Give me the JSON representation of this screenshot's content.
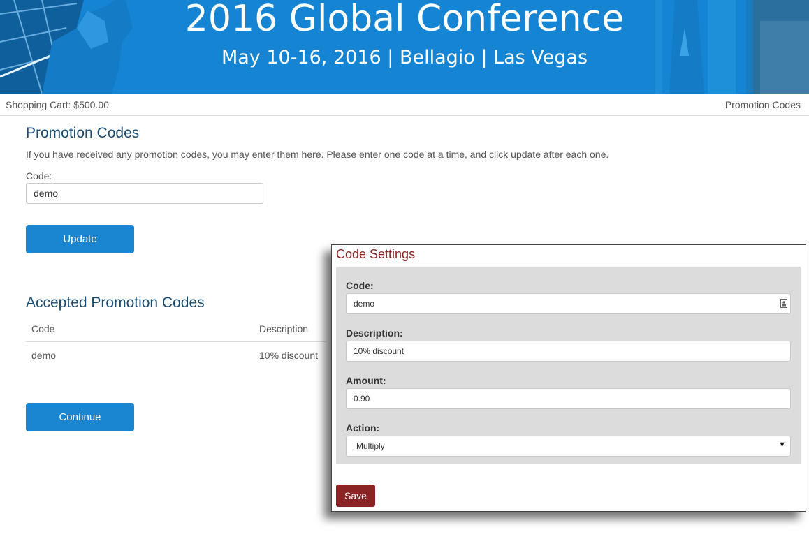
{
  "banner": {
    "title": "2016 Global Conference",
    "subtitle": "May 10-16, 2016 | Bellagio | Las Vegas",
    "color": "#1585d3"
  },
  "topbar": {
    "cart": "Shopping Cart: $500.00",
    "promo_link": "Promotion Codes"
  },
  "promo": {
    "heading": "Promotion Codes",
    "intro": "If you have received any promotion codes, you may enter them here. Please enter one code at a time, and click update after each one.",
    "code_label": "Code:",
    "code_value": "demo",
    "update_label": "Update"
  },
  "accepted": {
    "heading": "Accepted Promotion Codes",
    "columns": [
      "Code",
      "Description"
    ],
    "rows": [
      {
        "code": "demo",
        "description": "10% discount"
      }
    ],
    "continue_label": "Continue"
  },
  "settings": {
    "title": "Code Settings",
    "code_label": "Code:",
    "code_value": "demo",
    "description_label": "Description:",
    "description_value": "10% discount",
    "amount_label": "Amount:",
    "amount_value": "0.90",
    "action_label": "Action:",
    "action_value": "Multiply",
    "save_label": "Save",
    "accent": "#8a2424"
  }
}
